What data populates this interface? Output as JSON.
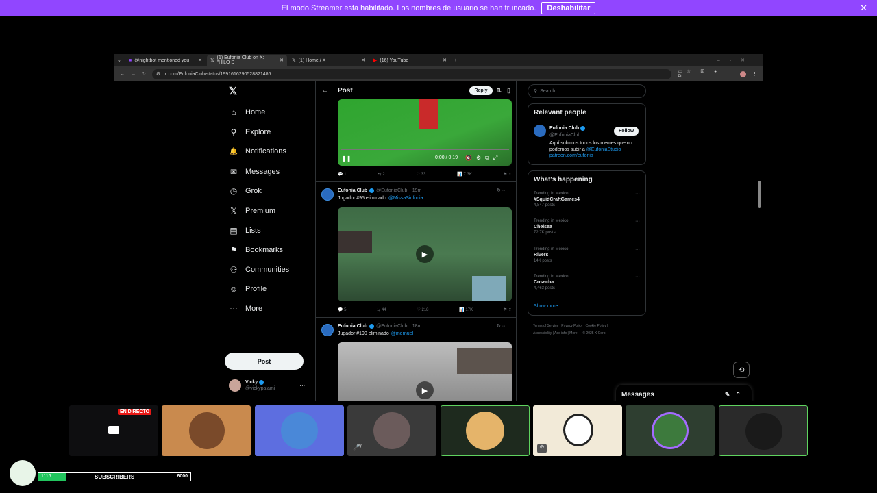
{
  "banner": {
    "text": "El modo Streamer está habilitado. Los nombres de usuario se han truncado.",
    "button": "Deshabilitar"
  },
  "tabs": [
    {
      "label": "@nightbot mentioned you"
    },
    {
      "label": "(1) Eufonia Club on X: \"HILO D"
    },
    {
      "label": "(1) Home / X"
    },
    {
      "label": "(16) YouTube"
    }
  ],
  "address": {
    "url": "x.com/EufoniaClub/status/1991616290528821486"
  },
  "nav": {
    "items": [
      {
        "label": "Home",
        "icon": "⌂"
      },
      {
        "label": "Explore",
        "icon": "⚲"
      },
      {
        "label": "Notifications",
        "icon": "🔔"
      },
      {
        "label": "Messages",
        "icon": "✉"
      },
      {
        "label": "Grok",
        "icon": "◷"
      },
      {
        "label": "Premium",
        "icon": "𝕏"
      },
      {
        "label": "Lists",
        "icon": "▤"
      },
      {
        "label": "Bookmarks",
        "icon": "⚑"
      },
      {
        "label": "Communities",
        "icon": "⚇"
      },
      {
        "label": "Profile",
        "icon": "☺"
      },
      {
        "label": "More",
        "icon": "⋯"
      }
    ],
    "post_button": "Post",
    "user": {
      "name": "Vicky",
      "handle": "@vickypalami"
    }
  },
  "header": {
    "title": "Post",
    "reply": "Reply"
  },
  "video1": {
    "time": "0:00 / 0:19",
    "counts": [
      "1",
      "2",
      "33",
      "7.3K"
    ]
  },
  "tweets": [
    {
      "name": "Eufonia Club",
      "handle": "@EufoniaClub",
      "age": "· 19m",
      "text": "Jugador #95 eliminado",
      "mention": "@MissaSinfonia",
      "counts": [
        "5",
        "44",
        "218",
        "17K"
      ]
    },
    {
      "name": "Eufonia Club",
      "handle": "@EufoniaClub",
      "age": "· 18m",
      "text": "Jugador #190 eliminado",
      "mention": "@mernuel_"
    }
  ],
  "search": {
    "placeholder": "Search"
  },
  "relevant": {
    "title": "Relevant people",
    "name": "Eufonia Club",
    "handle": "@EufoniaClub",
    "follow": "Follow",
    "bio1": "Aquí subimos todos los memes que no podemos subir a",
    "bio_link": "@EufoniaStudio",
    "bio_site": "patreon.com/eufonia"
  },
  "happening": {
    "title": "What's happening",
    "trends": [
      {
        "context": "Trending in Mexico",
        "name": "#SquidCraftGames4",
        "posts": "4,847 posts"
      },
      {
        "context": "Trending in Mexico",
        "name": "Chelsea",
        "posts": "72.7K posts"
      },
      {
        "context": "Trending in Mexico",
        "name": "Rivers",
        "posts": "14K posts"
      },
      {
        "context": "Trending in Mexico",
        "name": "Cosecha",
        "posts": "4,463 posts"
      }
    ],
    "show_more": "Show more"
  },
  "footer": {
    "line1": "Terms of Service  |  Privacy Policy  |  Cookie Policy  |",
    "line2": "Accessibility  |  Ads info  |  More ···  © 2025 X Corp."
  },
  "messages_drawer": {
    "title": "Messages"
  },
  "stream": {
    "live_label": "EN DIRECTO",
    "subs_count": "1116",
    "subs_label": "SUBSCRIBERS",
    "subs_goal": "6000",
    "subs_progress": 0.186
  },
  "colors": {
    "accent": "#9146ff",
    "x_blue": "#1d9bf0",
    "sub_bar": "#22c55e"
  }
}
